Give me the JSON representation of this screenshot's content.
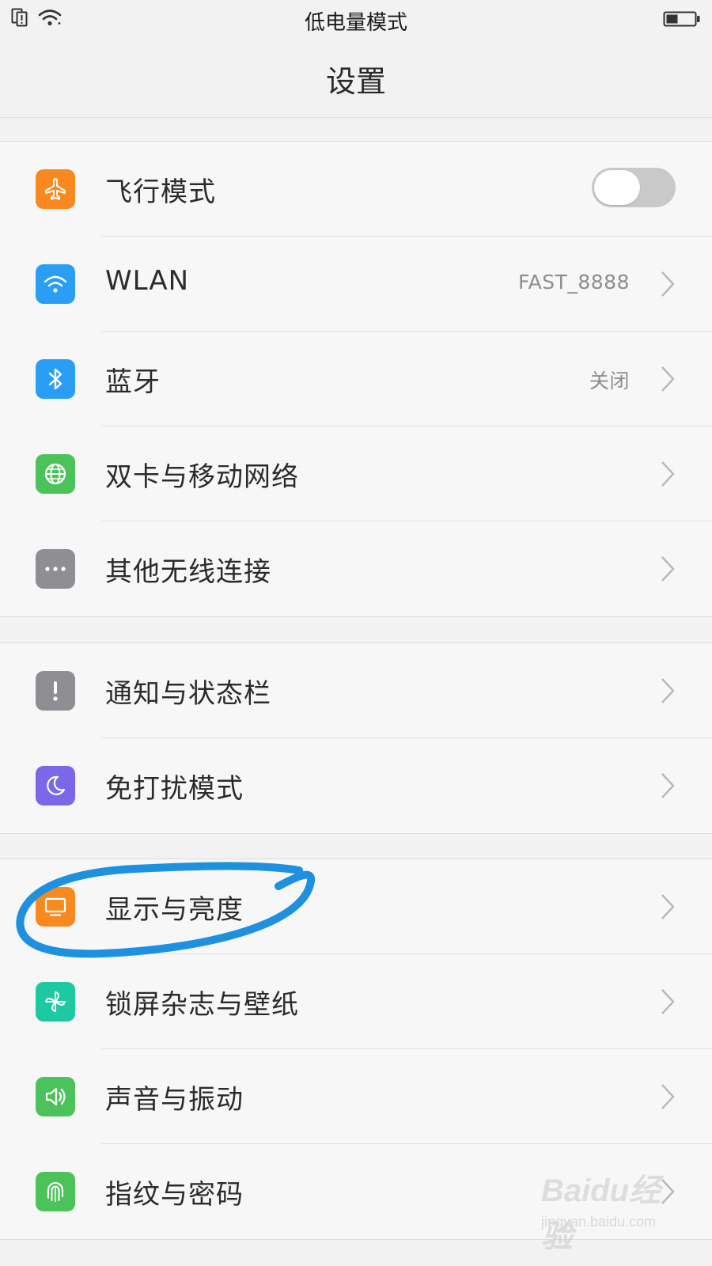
{
  "status_bar": {
    "title": "低电量模式",
    "sim_icon": "sim-card-alert-icon",
    "wifi_icon": "wifi-icon",
    "battery_icon": "battery-low-icon"
  },
  "header": {
    "title": "设置"
  },
  "groups": [
    {
      "items": [
        {
          "label": "飞行模式",
          "icon": "airplane-icon",
          "icon_color": "#f7891f",
          "control": "toggle",
          "toggle_on": false
        },
        {
          "label": "WLAN",
          "icon": "wifi-icon",
          "icon_color": "#2a9df4",
          "value": "FAST_8888",
          "control": "chevron"
        },
        {
          "label": "蓝牙",
          "icon": "bluetooth-icon",
          "icon_color": "#2a9df4",
          "value": "关闭",
          "control": "chevron"
        },
        {
          "label": "双卡与移动网络",
          "icon": "globe-icon",
          "icon_color": "#4cc35a",
          "control": "chevron"
        },
        {
          "label": "其他无线连接",
          "icon": "more-dots-icon",
          "icon_color": "#8e8e93",
          "control": "chevron"
        }
      ]
    },
    {
      "items": [
        {
          "label": "通知与状态栏",
          "icon": "exclamation-icon",
          "icon_color": "#8e8e93",
          "control": "chevron"
        },
        {
          "label": "免打扰模式",
          "icon": "moon-icon",
          "icon_color": "#7a68e8",
          "control": "chevron"
        }
      ]
    },
    {
      "items": [
        {
          "label": "显示与亮度",
          "icon": "monitor-icon",
          "icon_color": "#f7891f",
          "control": "chevron"
        },
        {
          "label": "锁屏杂志与壁纸",
          "icon": "pinwheel-icon",
          "icon_color": "#1ec8a0",
          "control": "chevron"
        },
        {
          "label": "声音与振动",
          "icon": "speaker-icon",
          "icon_color": "#4cc35a",
          "control": "chevron"
        },
        {
          "label": "指纹与密码",
          "icon": "fingerprint-icon",
          "icon_color": "#4cc35a",
          "control": "chevron"
        }
      ]
    }
  ],
  "annotation": {
    "color": "#1e90e0",
    "circled_item": "显示与亮度"
  },
  "watermark": {
    "brand": "Baidu经验",
    "url": "jingyan.baidu.com"
  }
}
